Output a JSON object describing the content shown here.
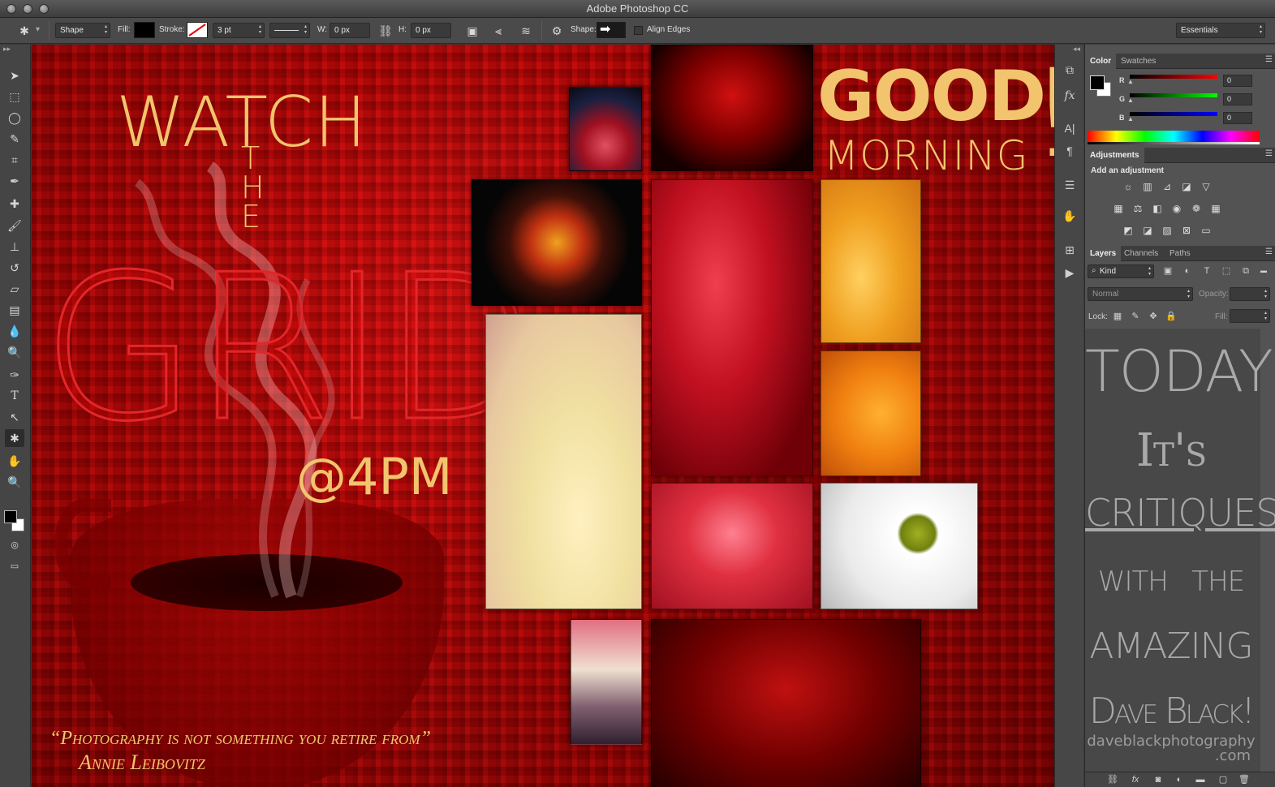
{
  "window": {
    "title": "Adobe Photoshop CC"
  },
  "options": {
    "mode": "Shape",
    "fill_label": "Fill:",
    "stroke_label": "Stroke:",
    "stroke_width": "3 pt",
    "w_label": "W:",
    "w_value": "0 px",
    "h_label": "H:",
    "h_value": "0 px",
    "shape_label": "Shape:",
    "align_edges": "Align Edges",
    "workspace": "Essentials"
  },
  "colors": {
    "canvas_red": "#c40a0a",
    "gold": "#f2c46d",
    "panel_bg": "#535353"
  },
  "poster": {
    "watch": "WATCH",
    "the_t": "T",
    "the_h": "H",
    "the_e": "E",
    "grid": "GRID",
    "time": "@4PM",
    "good": "GOOD",
    "morning": "MORNING",
    "exclaim": "!",
    "quote": "“Photography is not something you retire from”",
    "author": "Annie Leibovitz"
  },
  "color_panel": {
    "tabs": [
      "Color",
      "Swatches"
    ],
    "channels": [
      {
        "label": "R",
        "value": "0"
      },
      {
        "label": "G",
        "value": "0"
      },
      {
        "label": "B",
        "value": "0"
      }
    ]
  },
  "adjustments": {
    "tab": "Adjustments",
    "heading": "Add an adjustment"
  },
  "layers": {
    "tabs": [
      "Layers",
      "Channels",
      "Paths"
    ],
    "filter": "Kind",
    "blend": "Normal",
    "opacity_label": "Opacity:",
    "lock_label": "Lock:",
    "fill_label": "Fill:"
  },
  "side_poster": {
    "today": "TODAY",
    "its": "It's",
    "critiques": "CRITIQUES",
    "with": "WITH",
    "the": "THE",
    "amazing": "AMAZING",
    "name": "Dave Black!",
    "url1": "daveblackphotography",
    "url2": ".com"
  }
}
